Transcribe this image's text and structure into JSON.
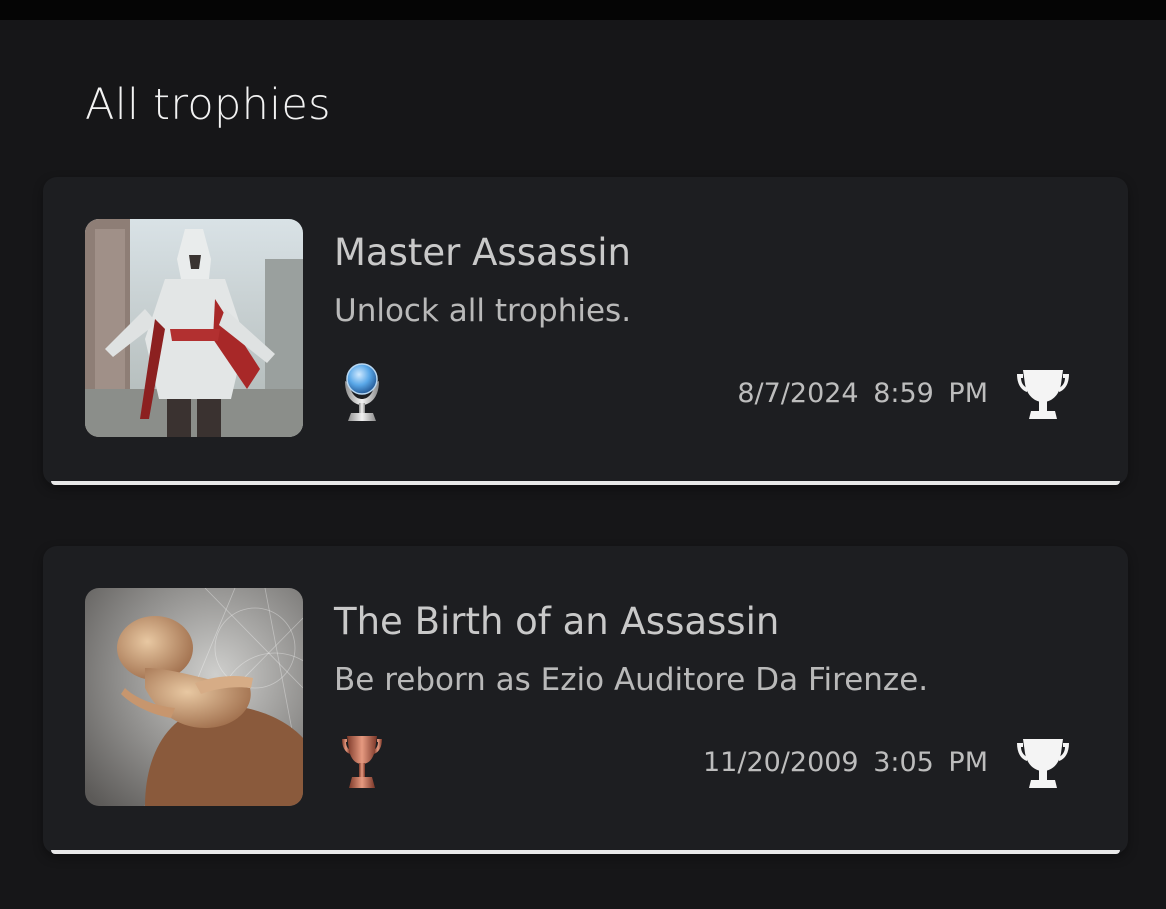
{
  "header": {
    "title": "All trophies"
  },
  "trophies": [
    {
      "name": "Master Assassin",
      "description": "Unlock all trophies.",
      "grade": "platinum",
      "date": "8/7/2024",
      "time": "8:59 PM",
      "earned_icon": "trophy-cup-icon"
    },
    {
      "name": "The Birth of an Assassin",
      "description": "Be reborn as Ezio Auditore Da Firenze.",
      "grade": "bronze",
      "date": "11/20/2009",
      "time": "3:05 PM",
      "earned_icon": "trophy-cup-icon"
    }
  ],
  "colors": {
    "background": "#161618",
    "card": "#1d1e21",
    "bronze": "#b9614a",
    "platinum_orb": "#5aa8e8"
  }
}
